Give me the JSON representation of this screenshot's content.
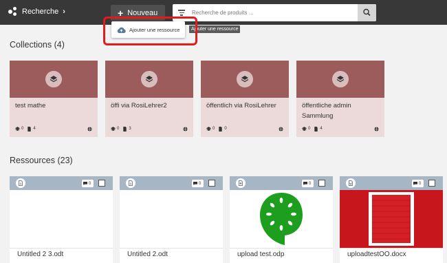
{
  "topbar": {
    "brand_label": "Recherche",
    "new_button_label": "Nouveau",
    "search_placeholder": "Recherche de produits ..."
  },
  "dropdown": {
    "item_label": "Ajouter une ressource",
    "tooltip": "Ajouter une ressource"
  },
  "collections": {
    "heading": "Collections (4)",
    "items": [
      {
        "title": "test mathe",
        "collections": "0",
        "files": "4"
      },
      {
        "title": "öffi via RosiLehrer2",
        "collections": "0",
        "files": "3"
      },
      {
        "title": "öffentlich via RosiLehrer",
        "collections": "0",
        "files": "0"
      },
      {
        "title": "öffentliche admin Sammlung",
        "collections": "0",
        "files": "4"
      }
    ]
  },
  "resources": {
    "heading": "Ressources (23)",
    "items": [
      {
        "name": "Untitled 2 3.odt",
        "comments": "0"
      },
      {
        "name": "Untitled 2.odt",
        "comments": "0"
      },
      {
        "name": "upload test.odp",
        "comments": "0"
      },
      {
        "name": "uploadtestOO.docx",
        "comments": "0"
      }
    ]
  },
  "colors": {
    "topbar": "#383838",
    "collection_header": "#9d5c5c",
    "collection_body": "#ecd9d9",
    "resource_header": "#a7b6c4",
    "highlight": "#e31b1b",
    "odp_green": "#1e9e1e",
    "docx_red": "#c8161d"
  }
}
